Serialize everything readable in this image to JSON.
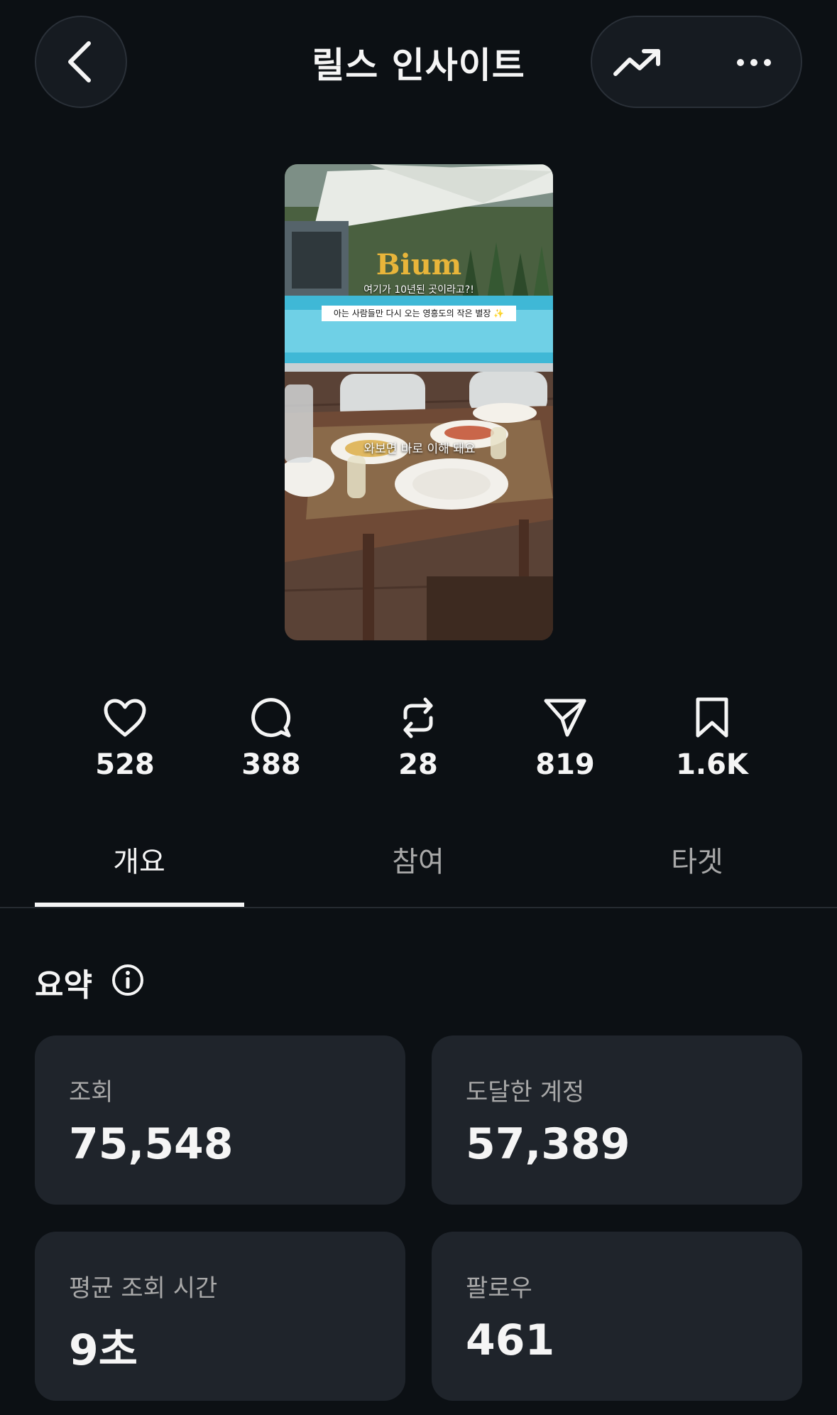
{
  "header": {
    "title": "릴스 인사이트"
  },
  "thumbnail": {
    "brand": "Bium",
    "line1": "여기가 10년된 곳이라고?!",
    "line2": "아는 사람들만 다시 오는 영흥도의 작은 별장 ✨",
    "caption": "와보면 바로 이해 돼요"
  },
  "stats": [
    {
      "icon": "heart-icon",
      "value": "528"
    },
    {
      "icon": "comment-icon",
      "value": "388"
    },
    {
      "icon": "repost-icon",
      "value": "28"
    },
    {
      "icon": "share-icon",
      "value": "819"
    },
    {
      "icon": "bookmark-icon",
      "value": "1.6K"
    }
  ],
  "tabs": [
    {
      "label": "개요",
      "active": true
    },
    {
      "label": "참여",
      "active": false
    },
    {
      "label": "타겟",
      "active": false
    }
  ],
  "summary": {
    "title": "요약",
    "cards": [
      {
        "label": "조회",
        "value": "75,548"
      },
      {
        "label": "도달한 계정",
        "value": "57,389"
      },
      {
        "label": "평균 조회 시간",
        "value": "9초"
      },
      {
        "label": "팔로우",
        "value": "461"
      }
    ]
  },
  "colors": {
    "background": "#0c1014",
    "card": "#1f242b",
    "text_primary": "#f5f5f5",
    "text_secondary": "#a8a8a8"
  }
}
